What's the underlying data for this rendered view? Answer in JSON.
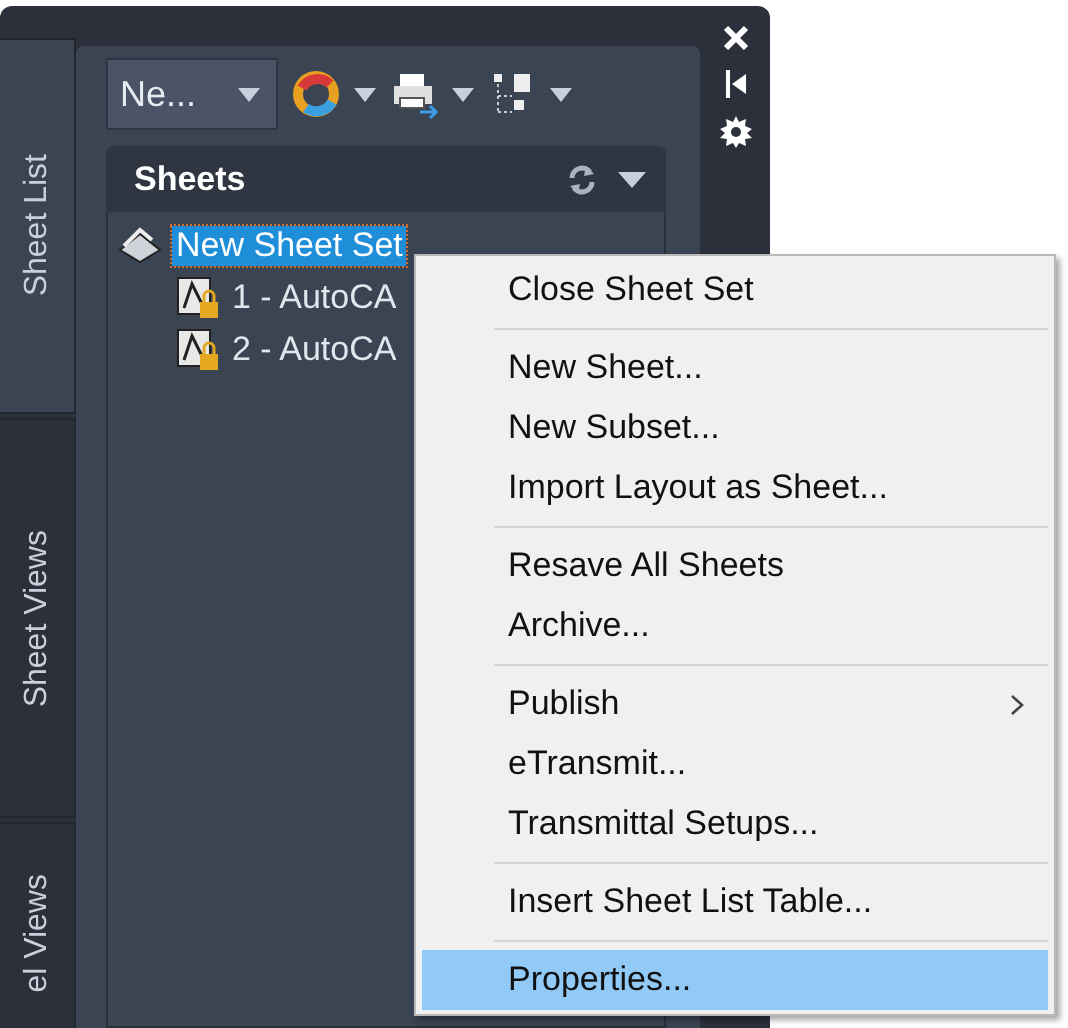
{
  "side_tabs": [
    {
      "label": "Sheet List",
      "selected": true
    },
    {
      "label": "Sheet Views",
      "selected": false
    },
    {
      "label": "el Views",
      "selected": false
    }
  ],
  "toolbar": {
    "dropdown": "Ne..."
  },
  "panel": {
    "title": "Sheets"
  },
  "tree": [
    {
      "label": "New Sheet Set",
      "selected": true,
      "children": [
        {
          "label": "1 - AutoCA",
          "selected": false
        },
        {
          "label": "2 - AutoCA",
          "selected": false
        }
      ]
    }
  ],
  "context_menu": [
    {
      "kind": "item",
      "label": "Close Sheet Set",
      "selected": false
    },
    {
      "kind": "separator"
    },
    {
      "kind": "item",
      "label": "New Sheet...",
      "selected": false
    },
    {
      "kind": "item",
      "label": "New Subset...",
      "selected": false
    },
    {
      "kind": "item",
      "label": "Import Layout as Sheet...",
      "selected": false
    },
    {
      "kind": "separator"
    },
    {
      "kind": "item",
      "label": "Resave All Sheets",
      "selected": false
    },
    {
      "kind": "item",
      "label": "Archive...",
      "selected": false
    },
    {
      "kind": "separator"
    },
    {
      "kind": "submenu",
      "label": "Publish",
      "selected": false
    },
    {
      "kind": "item",
      "label": "eTransmit...",
      "selected": false
    },
    {
      "kind": "item",
      "label": "Transmittal Setups...",
      "selected": false
    },
    {
      "kind": "separator"
    },
    {
      "kind": "item",
      "label": "Insert Sheet List Table...",
      "selected": false
    },
    {
      "kind": "separator"
    },
    {
      "kind": "item",
      "label": "Properties...",
      "selected": true
    }
  ]
}
